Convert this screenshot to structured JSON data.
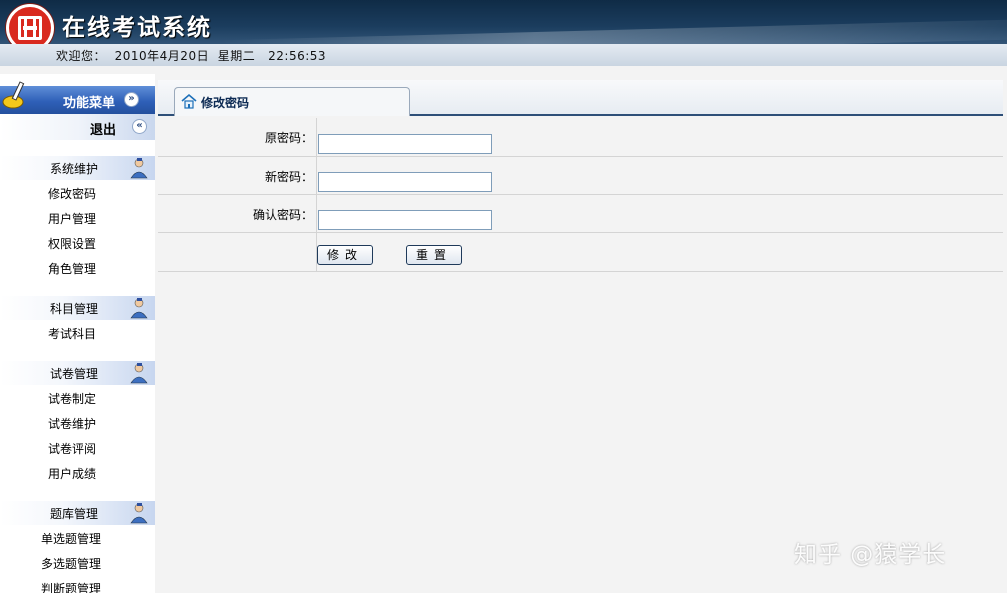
{
  "header": {
    "title": "在线考试系统",
    "welcome": "欢迎您：  2010年4月20日  星期二   22:56:53"
  },
  "sidebar": {
    "menu_title": "功能菜单",
    "logout": "退出",
    "groups": [
      {
        "title": "系统维护",
        "items": [
          "修改密码",
          "用户管理",
          "权限设置",
          "角色管理"
        ]
      },
      {
        "title": "科目管理",
        "items": [
          "考试科目"
        ]
      },
      {
        "title": "试卷管理",
        "items": [
          "试卷制定",
          "试卷维护",
          "试卷评阅",
          "用户成绩"
        ]
      },
      {
        "title": "题库管理",
        "items": [
          "单选题管理",
          "多选题管理",
          "判断题管理"
        ]
      }
    ]
  },
  "main": {
    "tab_label": "修改密码",
    "form": {
      "old_password_label": "原密码：",
      "old_password_value": "",
      "new_password_label": "新密码：",
      "new_password_value": "",
      "confirm_password_label": "确认密码：",
      "confirm_password_value": "",
      "submit_label": "修改",
      "reset_label": "重置"
    }
  },
  "watermark": "知乎 @猿学长",
  "colors": {
    "header_dark": "#0f2b46",
    "menu_blue": "#2f60b8",
    "logo_red": "#d92a1f"
  }
}
